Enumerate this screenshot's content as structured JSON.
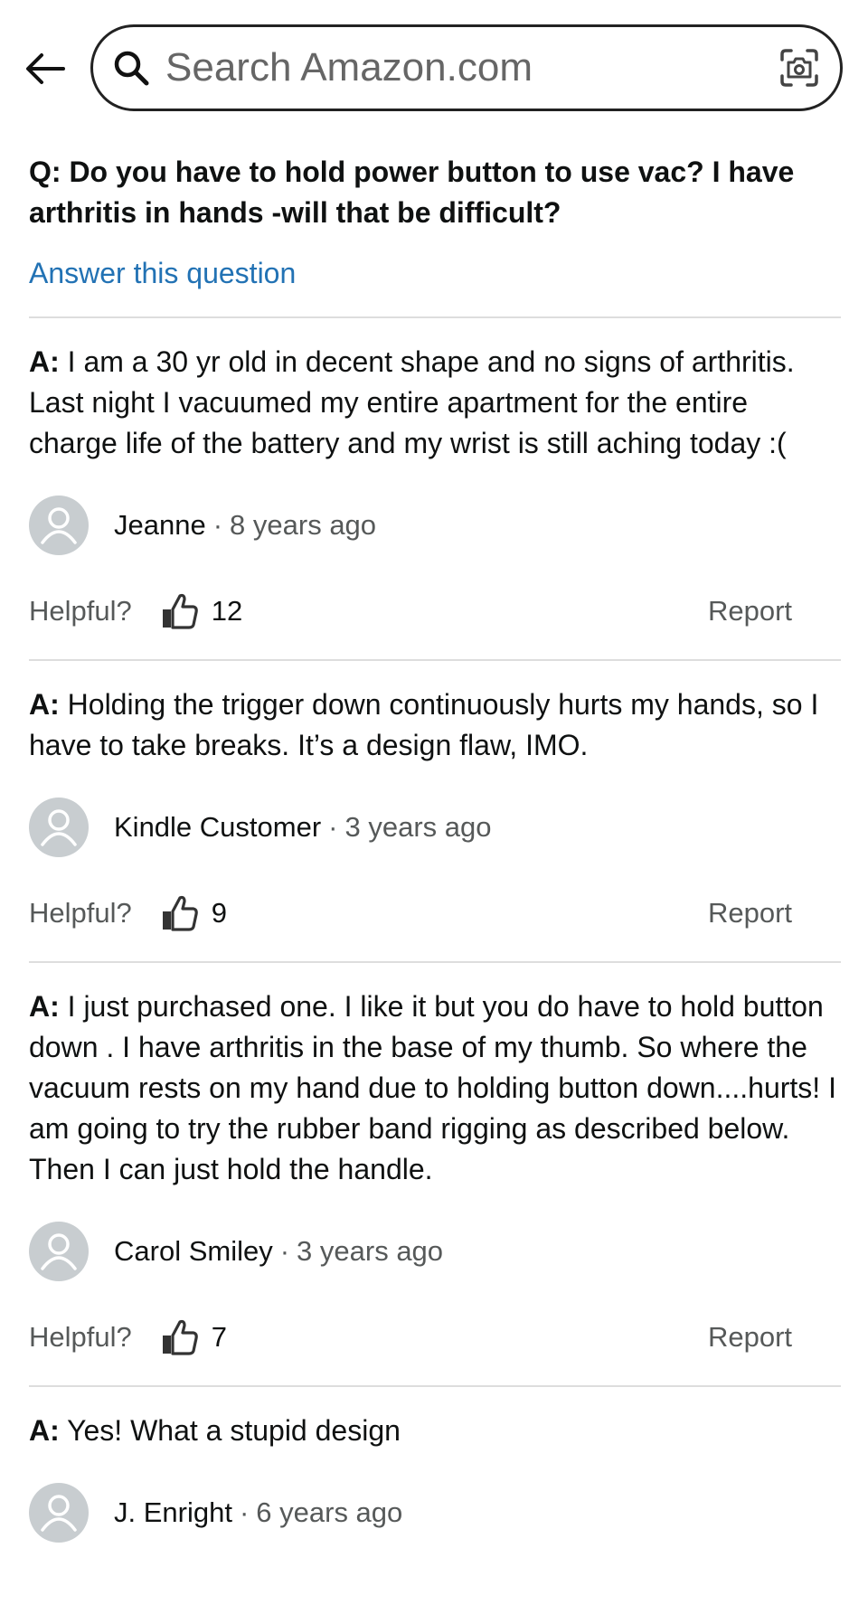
{
  "header": {
    "search_placeholder": "Search Amazon.com",
    "icons": [
      "back-arrow-icon",
      "search-icon",
      "camera-lens-icon"
    ]
  },
  "question": {
    "prefix": "Q:",
    "text": "Do you have to hold power button to use vac? I have arthritis in hands -will that be difficult?",
    "answer_link": "Answer this question"
  },
  "labels": {
    "answer_prefix": "A:",
    "helpful": "Helpful?",
    "report": "Report",
    "separator": "·"
  },
  "answers": [
    {
      "text": "I am a 30 yr old in decent shape and no signs of arthritis. Last night I vacuumed my entire apartment for the entire charge life of the battery and my wrist is still aching today :(",
      "author": "Jeanne",
      "time": "8 years ago",
      "helpful_count": "12"
    },
    {
      "text": "Holding the trigger down continuously hurts my hands, so I have to take breaks. It’s a design flaw, IMO.",
      "author": "Kindle Customer",
      "time": "3 years ago",
      "helpful_count": "9"
    },
    {
      "text": "I just purchased one. I like it but you do have to hold button down . I have arthritis in the base of my thumb. So where the vacuum rests on my hand due to holding button down....hurts! I am going to try the rubber band rigging as described below. Then I can just hold the handle.",
      "author": "Carol Smiley",
      "time": "3 years ago",
      "helpful_count": "7"
    },
    {
      "text": "Yes! What a stupid design",
      "author": "J. Enright",
      "time": "6 years ago"
    }
  ],
  "colors": {
    "link": "#2272b4",
    "secondary_text": "#565959",
    "divider": "#dddddd",
    "avatar": "#c8cdd0"
  }
}
